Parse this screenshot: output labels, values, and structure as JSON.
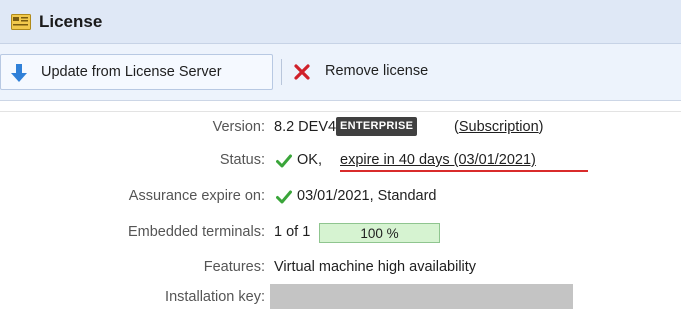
{
  "header": {
    "title": "License",
    "icon": "license-card-icon"
  },
  "toolbar": {
    "update_label": "Update from License Server",
    "update_icon": "download-arrow-icon",
    "remove_label": "Remove license",
    "remove_icon": "red-x-icon"
  },
  "fields": {
    "version_label": "Version:",
    "version_value": "8.2 DEV4",
    "edition_badge": "ENTERPRISE",
    "subscription_open": "(",
    "subscription_link": "Subscription",
    "subscription_close": ")",
    "status_label": "Status:",
    "status_ok": "OK,",
    "status_expire": "expire in 40 days (03/01/2021)",
    "assurance_label": "Assurance expire on:",
    "assurance_value": "03/01/2021, Standard",
    "terminals_label": "Embedded terminals:",
    "terminals_value": "1 of 1",
    "terminals_progress_text": "100 %",
    "terminals_progress_fraction": 1.0,
    "features_label": "Features:",
    "features_value": "Virtual machine high availability",
    "installation_key_label": "Installation key:"
  },
  "colors": {
    "header_bg": "#dfe8f6",
    "toolbar_bg": "#edf3fc",
    "check_green": "#3aa53a",
    "remove_red": "#d0202a",
    "update_blue": "#2f80d8",
    "warning_underline": "#d92b2b",
    "progress_green": "#d6f3d1"
  }
}
